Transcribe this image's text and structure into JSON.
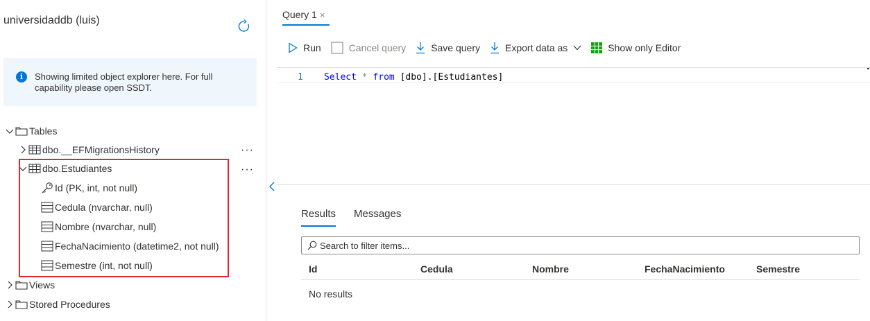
{
  "explorer": {
    "title": "universidaddb (luis)",
    "info": "Showing limited object explorer here. For full capability please open SSDT.",
    "tables_label": "Tables",
    "table1": "dbo.__EFMigrationsHistory",
    "table2": "dbo.Estudiantes",
    "columns": [
      "Id (PK, int, not null)",
      "Cedula (nvarchar, null)",
      "Nombre (nvarchar, null)",
      "FechaNacimiento (datetime2, not null)",
      "Semestre (int, not null)"
    ],
    "views_label": "Views",
    "procs_label": "Stored Procedures",
    "more": "···"
  },
  "query_tab": {
    "label": "Query 1",
    "close": "×"
  },
  "toolbar": {
    "run": "Run",
    "cancel": "Cancel query",
    "save": "Save query",
    "export": "Export data as",
    "show_editor": "Show only Editor"
  },
  "editor": {
    "line_number": "1",
    "kw_select": "Select",
    "star": "*",
    "kw_from": "from",
    "target": "[dbo].[Estudiantes]"
  },
  "results": {
    "tab_results": "Results",
    "tab_messages": "Messages",
    "filter_placeholder": "Search to filter items...",
    "columns": [
      "Id",
      "Cedula",
      "Nombre",
      "FechaNacimiento",
      "Semestre"
    ],
    "empty": "No results"
  },
  "colors": {
    "accent": "#0078d4",
    "highlight": "#e0282e",
    "grid_icon": "#13a10e"
  }
}
